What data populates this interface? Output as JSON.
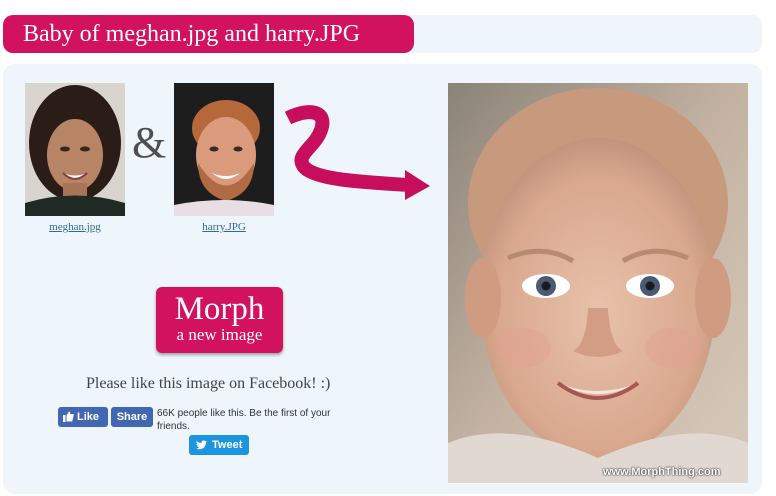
{
  "header": {
    "title": "Baby of meghan.jpg and harry.JPG"
  },
  "inputs": {
    "first": {
      "filename": "meghan.jpg"
    },
    "second": {
      "filename": "harry.JPG"
    },
    "separator": "&"
  },
  "morph_button": {
    "big": "Morph",
    "small": "a new image"
  },
  "social": {
    "prompt": "Please like this image on Facebook! :)",
    "like_label": "Like",
    "share_label": "Share",
    "count_text": "66K people like this. Be the first of your friends.",
    "tweet_label": "Tweet"
  },
  "result": {
    "watermark": "www.MorphThing.com"
  },
  "colors": {
    "accent": "#d2115f",
    "panel": "#eef5fb",
    "facebook": "#4267b2",
    "twitter": "#1b95e0"
  }
}
